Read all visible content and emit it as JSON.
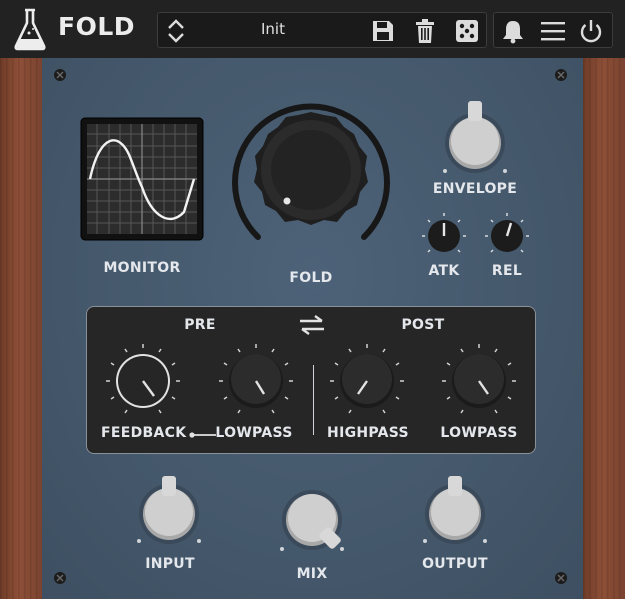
{
  "header": {
    "app_name": "FOLD",
    "preset": {
      "name": "Init"
    },
    "icons": [
      "flask-logo-icon",
      "up-down-arrows-icon",
      "save-icon",
      "trash-icon",
      "dice-icon",
      "bell-icon",
      "menu-icon",
      "power-icon"
    ]
  },
  "monitor": {
    "label": "MONITOR"
  },
  "fold": {
    "label": "FOLD"
  },
  "envelope": {
    "label": "ENVELOPE",
    "atk_label": "ATK",
    "rel_label": "REL"
  },
  "filter_section": {
    "pre_label": "PRE",
    "post_label": "POST",
    "feedback_label": "FEEDBACK",
    "pre_lowpass_label": "LOWPASS",
    "highpass_label": "HIGHPASS",
    "post_lowpass_label": "LOWPASS"
  },
  "bottom": {
    "input_label": "INPUT",
    "mix_label": "MIX",
    "output_label": "OUTPUT"
  },
  "colors": {
    "panel": "#46596d",
    "wood": "#7c4530",
    "topbar": "#222222",
    "label": "#e4e7eb"
  }
}
